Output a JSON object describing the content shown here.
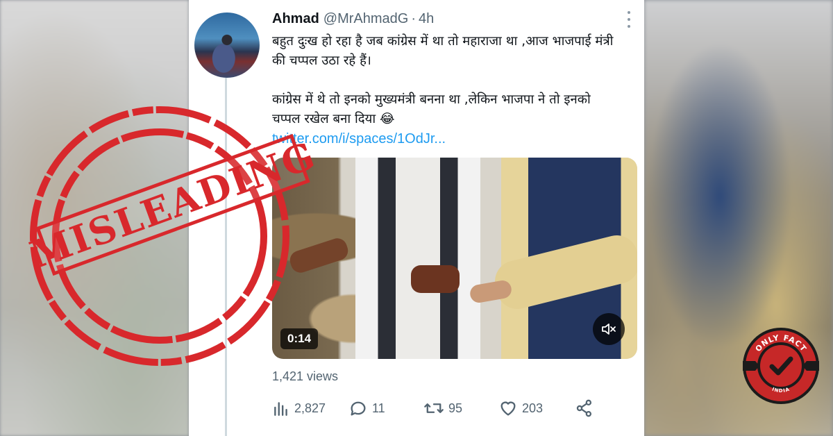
{
  "tweet": {
    "display_name": "Ahmad",
    "handle": "@MrAhmadG",
    "separator": "·",
    "time": "4h",
    "paragraph1": "बहुत दुःख हो रहा है जब कांग्रेस में था तो महाराजा था ,आज भाजपाई मंत्री की चप्पल उठा रहे हैं।",
    "paragraph2": "कांग्रेस में थे तो इनको मुख्यमंत्री बनना था ,लेकिन भाजपा ने तो इनको चप्पल रखेल बना दिया 😂",
    "link": "twitter.com/i/spaces/1OdJr..."
  },
  "video": {
    "duration": "0:14",
    "mute_icon": "volume-muted-icon"
  },
  "stats": {
    "views": "1,421 views",
    "analytics_count": "2,827",
    "replies": "11",
    "retweets": "95",
    "likes": "203"
  },
  "icons": {
    "analytics": "bar-chart-icon",
    "reply": "comment-icon",
    "retweet": "retweet-icon",
    "like": "heart-icon",
    "share": "share-icon",
    "more": "more-vertical-icon"
  },
  "overlay": {
    "stamp_text": "MISLEADING",
    "stamp_color": "#d8282c",
    "logo_text_top": "ONLY FACT",
    "logo_text_bottom": "INDIA",
    "logo_color": "#c62828"
  },
  "colors": {
    "link": "#1d9bf0",
    "secondary_text": "#536471",
    "primary_text": "#0f1419"
  }
}
